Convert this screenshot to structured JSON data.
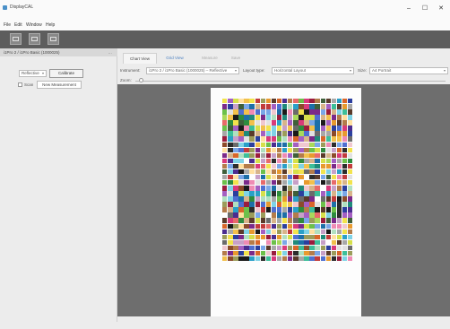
{
  "window": {
    "title": "DisplayCAL",
    "minimize": "–",
    "maximize": "☐",
    "close": "✕"
  },
  "menu": [
    "File",
    "Edit",
    "Window",
    "Help"
  ],
  "toolbar": {
    "icons": [
      "target-icon",
      "chart-icon",
      "measure-icon"
    ]
  },
  "sidebar": {
    "device": "i1Pro 2 / i1Pro Basic (1000025)",
    "device_extra": "…",
    "mode": "Reflective",
    "calibrate_label": "Calibrate",
    "scan_label": "Scan",
    "new_measurement_label": "New Measurement"
  },
  "tabs": [
    {
      "label": "Chart View",
      "state": "active"
    },
    {
      "label": "Grid View",
      "state": "normal"
    },
    {
      "label": "Measure",
      "state": "disabled"
    },
    {
      "label": "Save",
      "state": "disabled"
    }
  ],
  "options": {
    "instrument_label": "Instrument:",
    "instrument_value": "i1Pro 2 / i1Pro Basic (1000025) – Reflective",
    "layout_label": "Layout type:",
    "layout_value": "Horizontal Layout",
    "size_label": "Size:",
    "size_value": "A4 Portrait"
  },
  "zoom": {
    "label": "Zoom:",
    "level": 0.02
  },
  "chart": {
    "rows": 30,
    "cols": 24,
    "palette": [
      "#1a1a1a",
      "#2c2c2c",
      "#ffffff",
      "#e2e2e2",
      "#a8a8a8",
      "#6b6b6b",
      "#c23b3b",
      "#e86a6a",
      "#9b1c3d",
      "#d93a7a",
      "#ef8bb4",
      "#7b2a8a",
      "#a45fc2",
      "#4b2d8f",
      "#2b3f9e",
      "#4f6fd1",
      "#7aa7e8",
      "#1d6fa8",
      "#2aa0c8",
      "#7fd3e6",
      "#1f8a7a",
      "#3cbf9a",
      "#2e8b3e",
      "#6cc04a",
      "#a9d95b",
      "#d6e04a",
      "#f2e34c",
      "#f2c14c",
      "#e89a2f",
      "#d9662a",
      "#8c4a2a",
      "#b47c4a",
      "#d8b48a",
      "#5a3a2a",
      "#3f5f3a",
      "#9c9c5a",
      "#c7a0c8",
      "#f0c8d0",
      "#b0e0c0",
      "#ffe0a0"
    ]
  }
}
